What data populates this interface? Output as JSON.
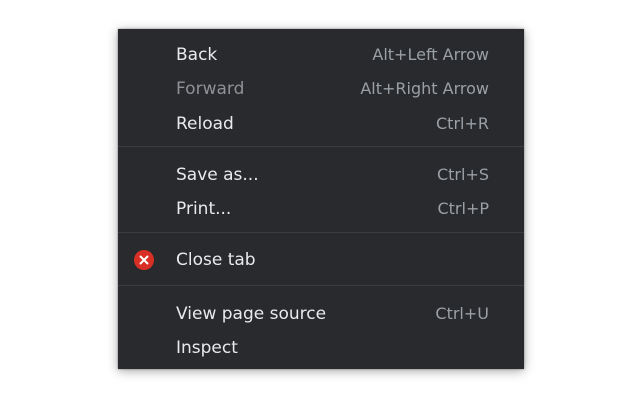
{
  "menu": {
    "items": [
      {
        "label": "Back",
        "shortcut": "Alt+Left Arrow",
        "enabled": true
      },
      {
        "label": "Forward",
        "shortcut": "Alt+Right Arrow",
        "enabled": false
      },
      {
        "label": "Reload",
        "shortcut": "Ctrl+R",
        "enabled": true
      },
      {
        "label": "Save as...",
        "shortcut": "Ctrl+S",
        "enabled": true
      },
      {
        "label": "Print...",
        "shortcut": "Ctrl+P",
        "enabled": true
      },
      {
        "label": "Close tab",
        "shortcut": "",
        "enabled": true,
        "icon": "close-circle-icon",
        "icon_color": "#d93025"
      },
      {
        "label": "View page source",
        "shortcut": "Ctrl+U",
        "enabled": true
      },
      {
        "label": "Inspect",
        "shortcut": "",
        "enabled": true
      }
    ]
  },
  "colors": {
    "menu_background": "#292a2d",
    "text": "#e8eaed",
    "shortcut_text": "#9aa0a6",
    "separator": "#3c3d40"
  }
}
